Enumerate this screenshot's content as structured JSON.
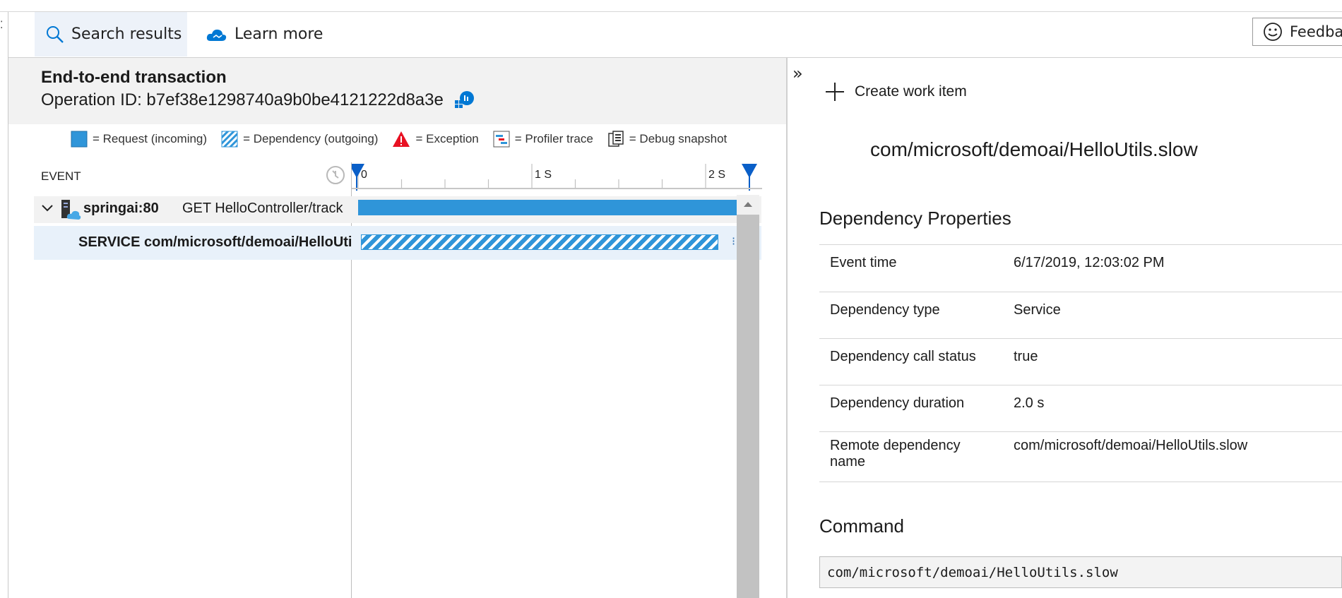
{
  "toolbar": {
    "search_label": "Search results",
    "learn_label": "Learn more",
    "feedback_label": "Feedba"
  },
  "left_edge_mark": "⁚",
  "transaction": {
    "title": "End-to-end transaction",
    "operation_label": "Operation ID: b7ef38e1298740a9b0be4121222d8a3e"
  },
  "legend": {
    "request": "= Request (incoming)",
    "dependency": "= Dependency (outgoing)",
    "exception": "= Exception",
    "profiler": "= Profiler trace",
    "debug": "= Debug snapshot"
  },
  "timeline": {
    "event_header": "EVENT",
    "ticks": [
      "0",
      "1 S",
      "2 S"
    ],
    "rows": [
      {
        "name": "springai:80",
        "desc": "GET HelloController/track",
        "duration_s": 2.1
      },
      {
        "name": "SERVICE com/microsoft/demoai/HelloUtils.slow",
        "duration_s": 2.0
      }
    ],
    "total_s": 2.1
  },
  "colors": {
    "accent": "#2f95d9",
    "brand": "#0078d4",
    "exception": "#e81123"
  },
  "detail": {
    "collapse_glyph": "»",
    "create_work_item": "Create work item",
    "title": "com/microsoft/demoai/HelloUtils.slow",
    "props_heading": "Dependency Properties",
    "properties": [
      {
        "key": "Event time",
        "value": "6/17/2019, 12:03:02 PM"
      },
      {
        "key": "Dependency type",
        "value": "Service"
      },
      {
        "key": "Dependency call status",
        "value": "true"
      },
      {
        "key": "Dependency duration",
        "value": "2.0 s"
      },
      {
        "key": "Remote dependency name",
        "value": "com/microsoft/demoai/HelloUtils.slow"
      }
    ],
    "command_heading": "Command",
    "command": "com/microsoft/demoai/HelloUtils.slow"
  }
}
